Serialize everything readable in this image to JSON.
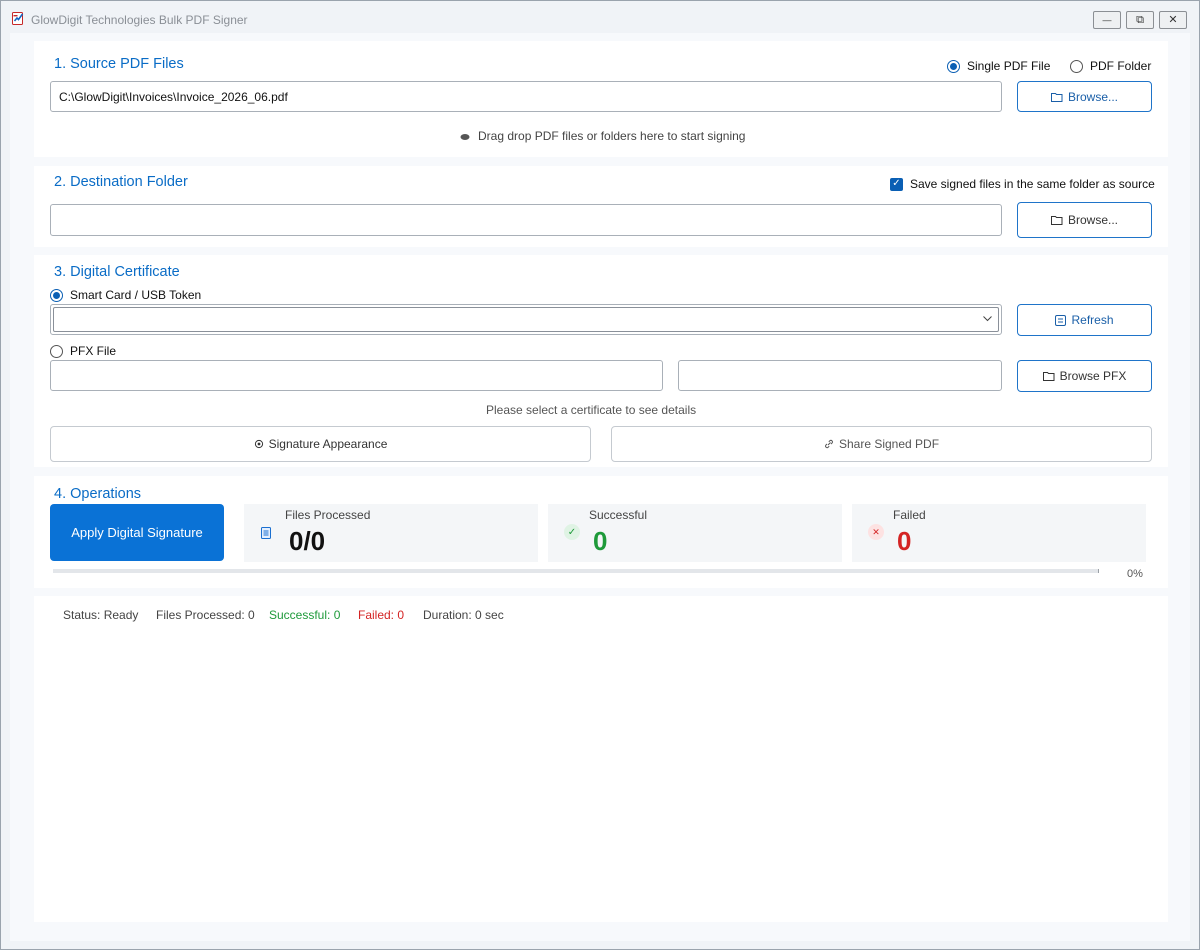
{
  "window": {
    "title": "GlowDigit Technologies Bulk PDF Signer",
    "minimize_glyph": "—",
    "restore_glyph": "⧉",
    "close_glyph": "✕"
  },
  "source": {
    "title": "1. Source PDF Files",
    "mode_single": "Single PDF File",
    "mode_folder": "PDF Folder",
    "selected_mode": "single",
    "path_value": "C:\\GlowDigit\\Invoices\\Invoice_2026_06.pdf",
    "browse_label": "Browse...",
    "drop_hint": "Drag  drop PDF files or folders here to start signing"
  },
  "destination": {
    "title": "2. Destination Folder",
    "same_folder_label": "Save signed files in the same folder as source",
    "same_folder_checked": true,
    "path_value": "",
    "browse_label": "Browse..."
  },
  "certificate": {
    "title": "3. Digital Certificate",
    "smart_card_label": "Smart Card / USB Token",
    "pfx_label": "PFX File",
    "selected_source": "smart_card",
    "token_selected": "",
    "refresh_label": "Refresh",
    "pfx_path": "",
    "pfx_password": "",
    "browse_pfx_label": "Browse PFX",
    "details_hint": "Please select a certificate to see details",
    "appearance_label": "Signature Appearance",
    "share_label": "Share Signed PDF"
  },
  "operations": {
    "title": "4. Operations",
    "apply_label": "Apply Digital Signature",
    "files_processed_label": "Files Processed",
    "files_processed_value": "0/0",
    "successful_label": "Successful",
    "successful_value": "0",
    "failed_label": "Failed",
    "failed_value": "0",
    "progress_percent": 0,
    "progress_text": "0%"
  },
  "status_bar": {
    "status": "Status: Ready",
    "files_processed": "Files Processed: 0",
    "successful": "Successful: 0",
    "failed": "Failed: 0",
    "duration": "Duration: 0 sec"
  },
  "colors": {
    "accent": "#0a6cc6",
    "success": "#1e9a3a",
    "danger": "#d42424"
  }
}
